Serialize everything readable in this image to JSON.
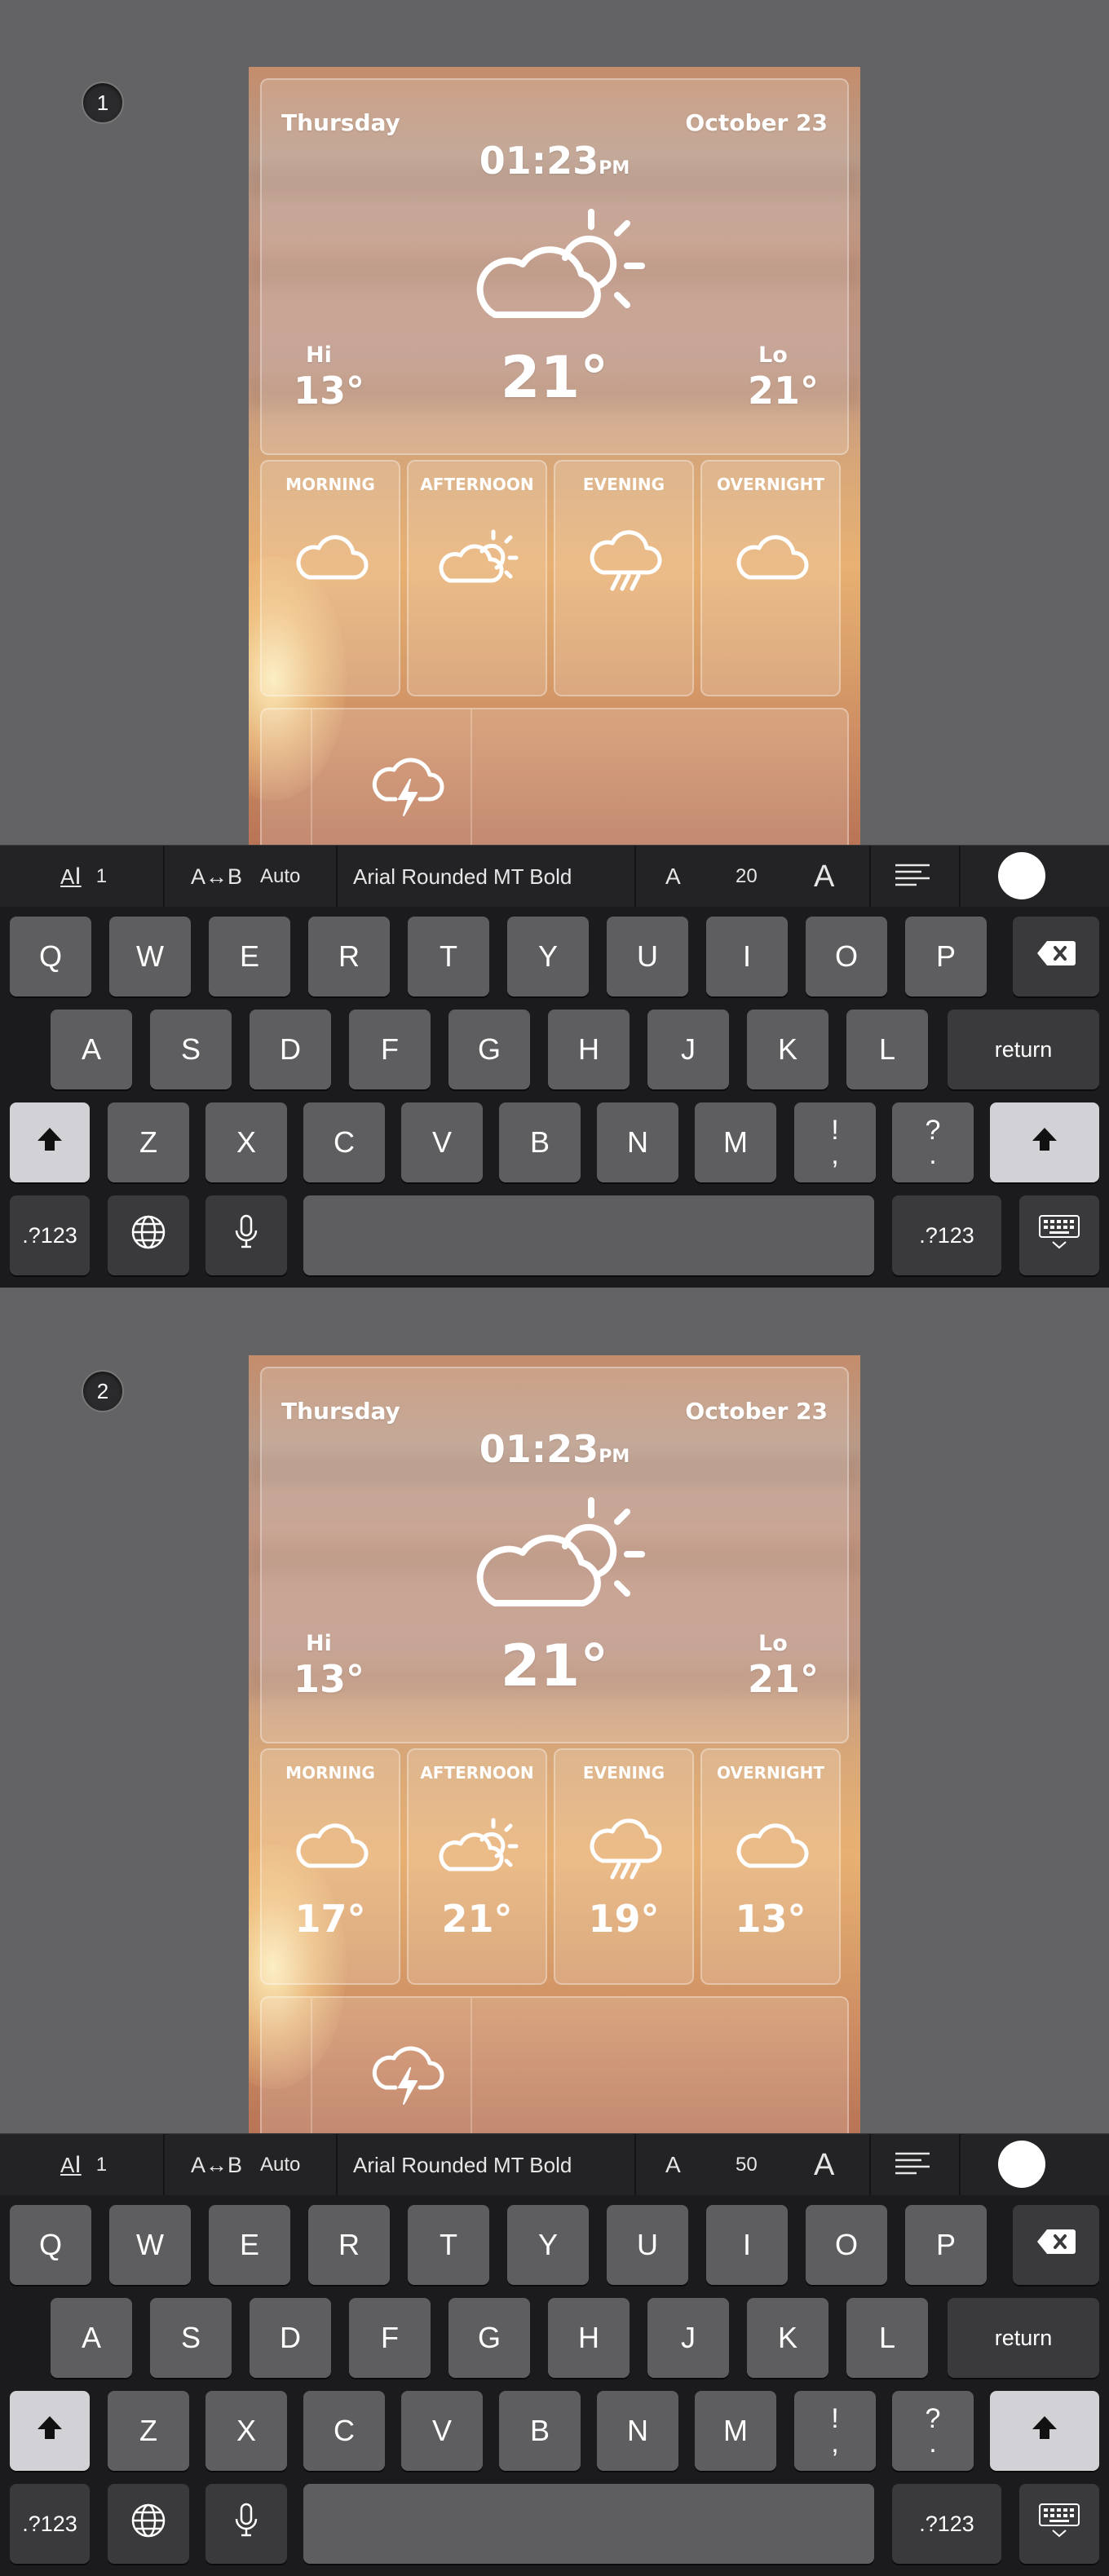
{
  "panels": [
    {
      "badge": "1",
      "weather": {
        "day": "Thursday",
        "date": "October 23",
        "time": "01:23",
        "ampm": "PM",
        "current_temp": "21°",
        "hi_label": "Hi",
        "hi_value": "13°",
        "lo_label": "Lo",
        "lo_value": "21°",
        "forecast": [
          {
            "label": "MORNING",
            "temp": "",
            "icon": "cloud-icon"
          },
          {
            "label": "AFTERNOON",
            "temp": "",
            "icon": "partly-sunny-icon"
          },
          {
            "label": "EVENING",
            "temp": "",
            "icon": "rain-cloud-icon"
          },
          {
            "label": "OVERNIGHT",
            "temp": "",
            "icon": "cloud-icon"
          }
        ]
      },
      "toolbar": {
        "line_spacing_value": "1",
        "char_spacing_label": "A↔B",
        "char_spacing_value": "Auto",
        "font_name": "Arial Rounded MT Bold",
        "font_size_small_a": "A",
        "font_size": "20",
        "font_size_large_a": "A"
      }
    },
    {
      "badge": "2",
      "weather": {
        "day": "Thursday",
        "date": "October 23",
        "time": "01:23",
        "ampm": "PM",
        "current_temp": "21°",
        "hi_label": "Hi",
        "hi_value": "13°",
        "lo_label": "Lo",
        "lo_value": "21°",
        "forecast": [
          {
            "label": "MORNING",
            "temp": "17°",
            "icon": "cloud-icon"
          },
          {
            "label": "AFTERNOON",
            "temp": "21°",
            "icon": "partly-sunny-icon"
          },
          {
            "label": "EVENING",
            "temp": "19°",
            "icon": "rain-cloud-icon"
          },
          {
            "label": "OVERNIGHT",
            "temp": "13°",
            "icon": "cloud-icon"
          }
        ]
      },
      "toolbar": {
        "line_spacing_value": "1",
        "char_spacing_label": "A↔B",
        "char_spacing_value": "Auto",
        "font_name": "Arial Rounded MT Bold",
        "font_size_small_a": "A",
        "font_size": "50",
        "font_size_large_a": "A"
      }
    }
  ],
  "keyboard": {
    "row1": [
      "Q",
      "W",
      "E",
      "R",
      "T",
      "Y",
      "U",
      "I",
      "O",
      "P"
    ],
    "row2": [
      "A",
      "S",
      "D",
      "F",
      "G",
      "H",
      "J",
      "K",
      "L"
    ],
    "row3": [
      "Z",
      "X",
      "C",
      "V",
      "B",
      "N",
      "M"
    ],
    "punct1": [
      "!",
      ","
    ],
    "punct2": [
      "?",
      "."
    ],
    "return_label": "return",
    "numbers_label": ".?123"
  },
  "colors": {
    "background": "#636365",
    "keyboard": "#1b1b1d",
    "key": "#5e5e60",
    "toolbar": "#232325"
  }
}
